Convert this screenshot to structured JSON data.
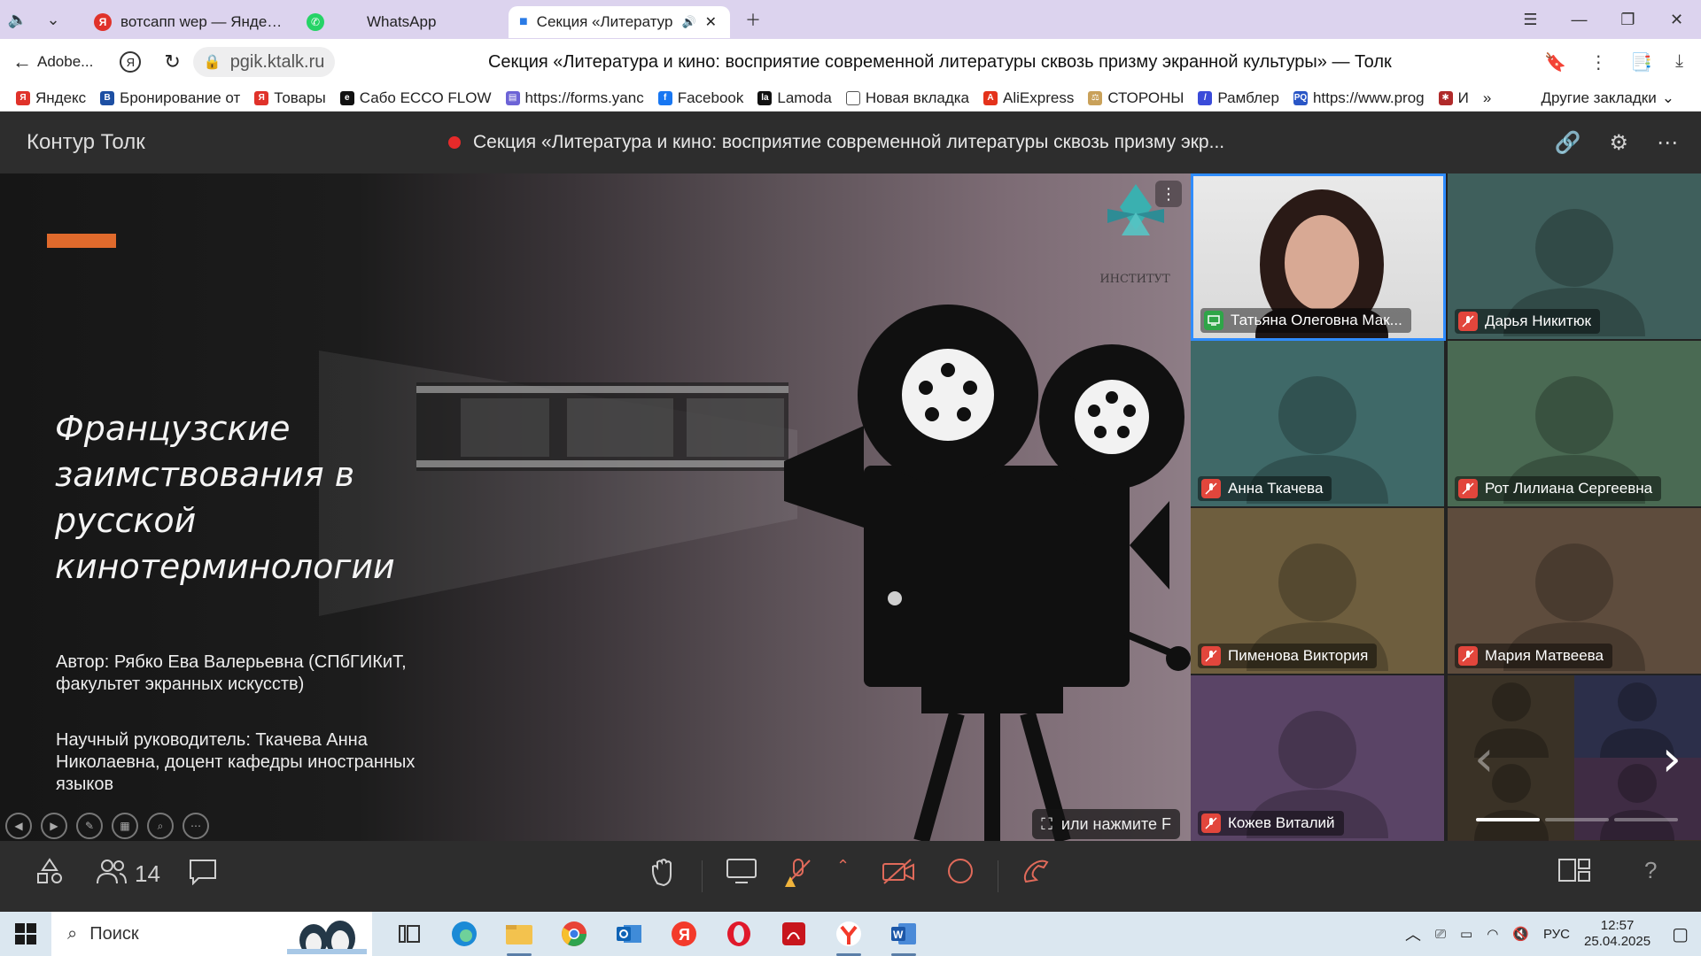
{
  "browser": {
    "tabs": [
      {
        "label": "вотсапп wep — Яндекс: на",
        "icon": "yandex-icon"
      },
      {
        "label": "WhatsApp",
        "icon": "whatsapp-icon"
      },
      {
        "label": "Секция «Литератур",
        "icon": "video-camera-icon",
        "active": true
      }
    ],
    "back_label": "Adobe...",
    "url": "pgik.ktalk.ru",
    "page_title": "Секция «Литература и кино: восприятие современной литературы сквозь призму экранной культуры» — Толк",
    "bookmarks": [
      "Яндекс",
      "Бронирование от",
      "Товары",
      "Сабо ECCO FLOW",
      "https://forms.yanc",
      "Facebook",
      "Lamoda",
      "Новая вкладка",
      "AliExpress",
      "СТОРОНЫ",
      "Рамблер",
      "https://www.prog",
      "И"
    ],
    "other_bookmarks": "Другие закладки"
  },
  "app": {
    "brand": "Контур Толк",
    "meeting_title": "Секция «Литература и кино: восприятие современной литературы сквозь призму экр..."
  },
  "slide": {
    "title": "Французские заимствования в русской кинотерминологии",
    "author": "Автор: Рябко Ева Валерьевна (СПбГИКиТ, факультет экранных искусств)",
    "advisor": "Научный руководитель: Ткачева Анна Николаевна, доцент кафедры иностранных языков",
    "fullscreen_hint": "или нажмите F",
    "logo_text": "ИНСТИТУТ"
  },
  "participants": [
    {
      "name": "Татьяна Олеговна Мак...",
      "bg": "#dcdcdc",
      "status": "screen",
      "video": true
    },
    {
      "name": "Дарья Никитюк",
      "bg": "#3f5f5c",
      "status": "muted"
    },
    {
      "name": "Анна Ткачева",
      "bg": "#3f6968",
      "status": "muted"
    },
    {
      "name": "Рот Лилиана Сергеевна",
      "bg": "#4a6a53",
      "status": "muted"
    },
    {
      "name": "Пименова Виктория",
      "bg": "#6e5e3e",
      "status": "muted"
    },
    {
      "name": "Мария Матвеева",
      "bg": "#5e4c3d",
      "status": "muted"
    },
    {
      "name": "Кожев Виталий",
      "bg": "#5a4466",
      "status": "muted"
    }
  ],
  "controls": {
    "participants_count": "14"
  },
  "taskbar": {
    "search_placeholder": "Поиск",
    "language": "РУС",
    "time": "12:57",
    "date": "25.04.2025"
  },
  "colors": {
    "accent_record": "#e62a2a",
    "accent_orange": "#e06a2c",
    "active_tile_border": "#2f8cff",
    "muted_red": "#e2463c"
  }
}
